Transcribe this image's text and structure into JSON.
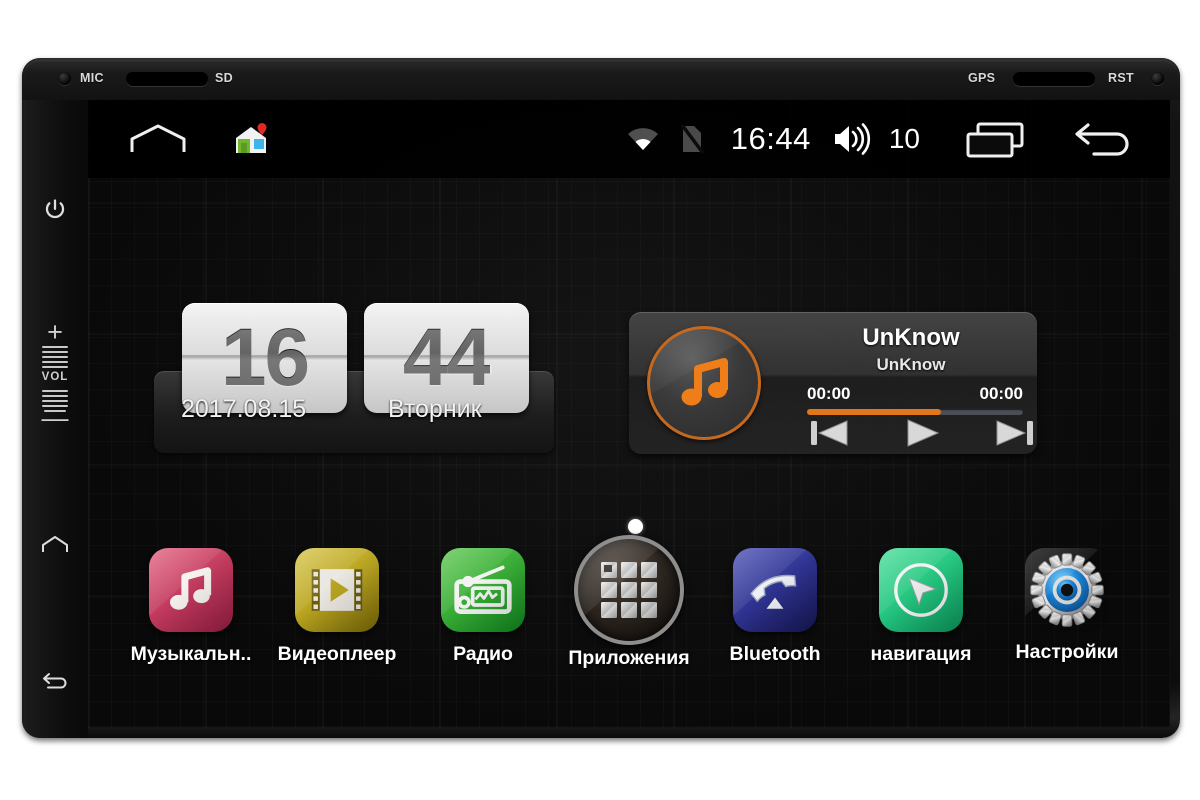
{
  "device": {
    "bezel": {
      "mic_label": "MIC",
      "sd_label": "SD",
      "gps_label": "GPS",
      "rst_label": "RST"
    },
    "side_buttons": {
      "power": "power-button",
      "vol_up": "+",
      "vol_label": "VOL",
      "vol_down": "I",
      "home": "home-button",
      "back": "back-button"
    }
  },
  "statusbar": {
    "home_icon": "home-outline-icon",
    "launcher_icon": "launcher-house-icon",
    "wifi_icon": "wifi-icon",
    "sd_off_icon": "sd-card-off-icon",
    "time": "16:44",
    "volume_icon": "speaker-volume-icon",
    "volume_level": "10",
    "recents_icon": "recent-apps-icon",
    "back_icon": "back-arrow-icon"
  },
  "clock_widget": {
    "hours": "16",
    "minutes": "44",
    "date": "2017.08.15",
    "weekday": "Вторник"
  },
  "music_widget": {
    "album_icon": "music-note-icon",
    "title": "UnKnow",
    "artist": "UnKnow",
    "elapsed": "00:00",
    "duration": "00:00",
    "progress_percent": 62,
    "accent_color": "#e2761b",
    "prev_icon": "previous-track-icon",
    "play_icon": "play-icon",
    "next_icon": "next-track-icon"
  },
  "home": {
    "page_indicator_dots": 1,
    "apps": [
      {
        "label": "Музыкальн..",
        "icon": "music-note-icon",
        "color": "#c8days",
        "bg_from": "#e05b7e",
        "bg_to": "#a8224a"
      },
      {
        "label": "Видеоплеер",
        "icon": "film-play-icon",
        "bg_from": "#d0bd33",
        "bg_to": "#8a7a10"
      },
      {
        "label": "Радио",
        "icon": "radio-icon",
        "bg_from": "#4cbb4c",
        "bg_to": "#159c2e"
      },
      {
        "label": "Приложения",
        "icon": "app-drawer-grid-icon",
        "bg_from": "#3c332c",
        "bg_to": "#15100c"
      },
      {
        "label": "Bluetooth",
        "icon": "phone-handset-icon",
        "bg_from": "#3b3fa0",
        "bg_to": "#1b1b60"
      },
      {
        "label": "навигация",
        "icon": "navigation-arrow-icon",
        "bg_from": "#35d18a",
        "bg_to": "#0f9a60"
      },
      {
        "label": "Настройки",
        "icon": "gear-icon",
        "bg_from": "#0b0b0b",
        "bg_to": "#0b0b0b"
      }
    ]
  }
}
